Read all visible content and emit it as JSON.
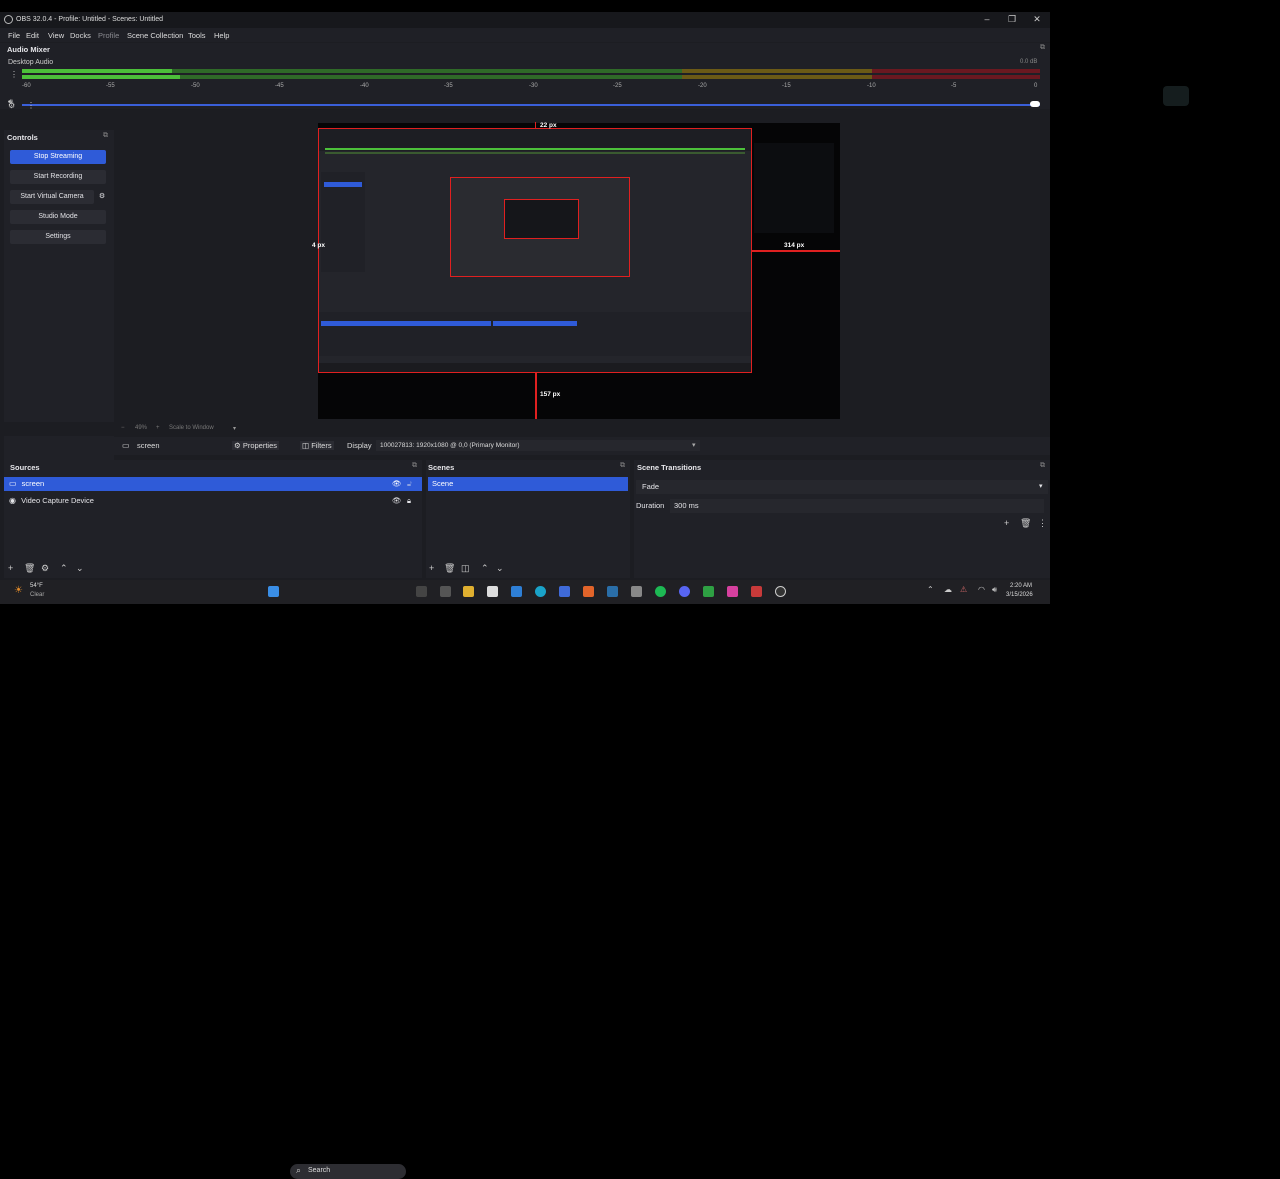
{
  "window": {
    "title": "OBS 32.0.4 - Profile: Untitled - Scenes: Untitled",
    "controls": [
      "–",
      "❐",
      "✕"
    ]
  },
  "menu": [
    "File",
    "Edit",
    "View",
    "Docks",
    "Profile",
    "Scene Collection",
    "Tools",
    "Help"
  ],
  "mixer": {
    "title": "Audio Mixer",
    "source_name": "Desktop Audio",
    "db_readout": "0.0 dB",
    "ticks": [
      "-60",
      "-55",
      "-50",
      "-45",
      "-40",
      "-35",
      "-30",
      "-25",
      "-20",
      "-15",
      "-10",
      "-5",
      "0"
    ],
    "volume_fraction": 1.0
  },
  "controls": {
    "title": "Controls",
    "buttons": [
      "Stop Streaming",
      "Start Recording",
      "Start Virtual Camera",
      "Studio Mode",
      "Settings"
    ]
  },
  "preview": {
    "top_measure": "22 px",
    "left_measure": "4 px",
    "right_measure": "314 px",
    "bottom_measure": "157 px",
    "zoom": "49%",
    "scale_mode": "Scale to Window"
  },
  "context": {
    "source": "screen",
    "properties": "Properties",
    "filters": "Filters",
    "display_label": "Display",
    "display_value": "100027813: 1920x1080 @ 0,0 (Primary Monitor)"
  },
  "sources": {
    "title": "Sources",
    "items": [
      "screen",
      "Video Capture Device"
    ]
  },
  "scenes": {
    "title": "Scenes",
    "items": [
      "Scene"
    ]
  },
  "transitions": {
    "title": "Scene Transitions",
    "type": "Fade",
    "duration_label": "Duration",
    "duration_value": "300 ms"
  },
  "taskbar": {
    "weather_temp": "54°F",
    "weather_desc": "Clear",
    "search": "Search",
    "time": "2:20 AM",
    "date": "3/15/2026"
  },
  "colors": {
    "accent": "#2f5bd8",
    "guide": "#e02020",
    "meter_green": "#4cc03a",
    "meter_yellow": "#b59a1e",
    "meter_red": "#b3202a"
  }
}
